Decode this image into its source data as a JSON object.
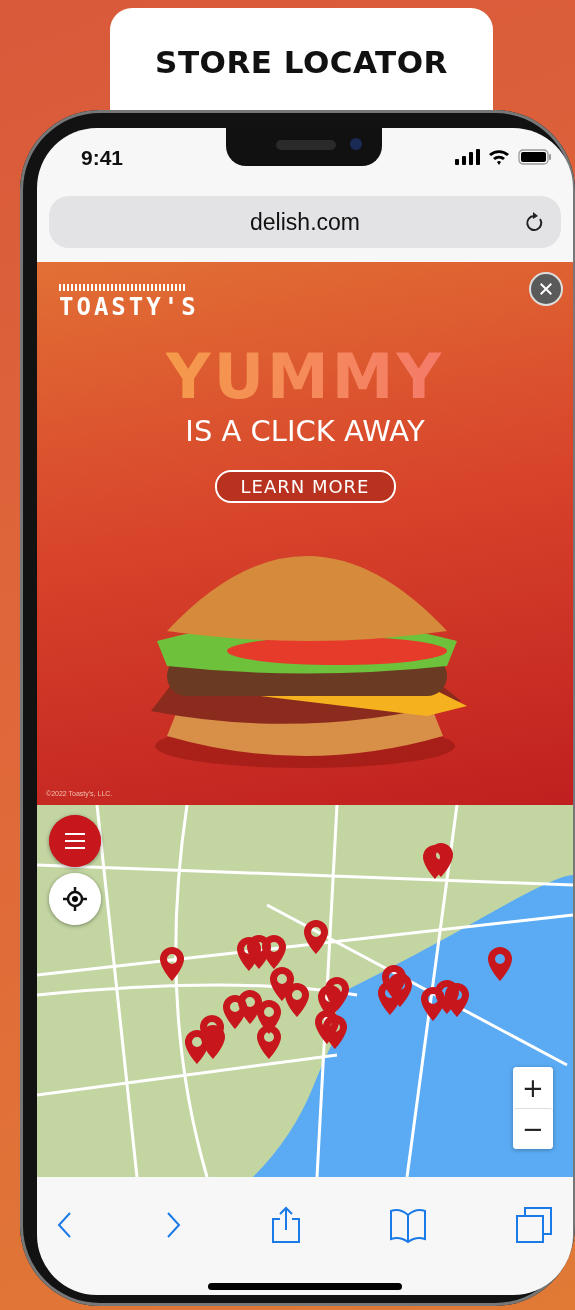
{
  "header": {
    "title": "STORE LOCATOR"
  },
  "status_bar": {
    "time": "9:41"
  },
  "address_bar": {
    "url": "delish.com"
  },
  "ad": {
    "brand": "TOASTY'S",
    "headline": "YUMMY",
    "tagline": "IS A CLICK AWAY",
    "button": "LEARN MORE",
    "copyright": "©2022 Toasty's, LLC."
  },
  "map": {
    "zoom_in": "+",
    "zoom_out": "−"
  }
}
